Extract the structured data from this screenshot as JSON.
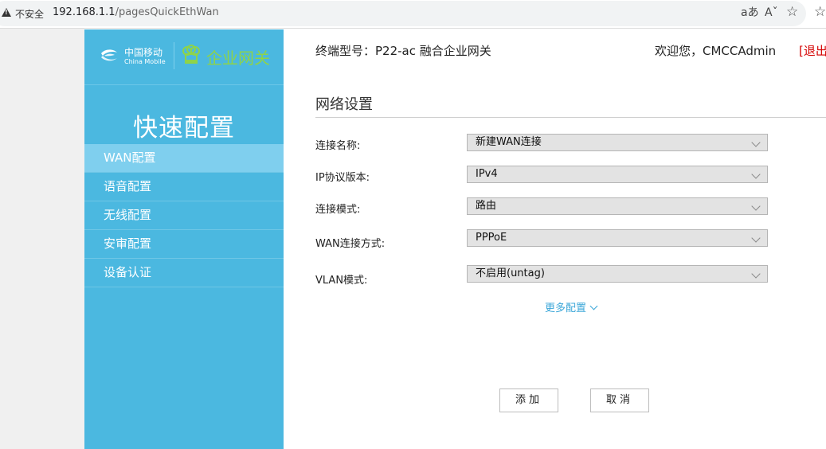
{
  "browser": {
    "security_text": "不安全",
    "url_host": "192.168.1.1",
    "url_path": "/pagesQuickEthWan",
    "icons": [
      "read-aloud-icon",
      "text-size-icon",
      "favorite-star-icon",
      "favorites-list-icon"
    ]
  },
  "sidebar": {
    "brand_cn": "中国移动",
    "brand_en": "China Mobile",
    "product_name": "企业网关",
    "title": "快速配置",
    "items": [
      {
        "label": "WAN配置",
        "active": true
      },
      {
        "label": "语音配置",
        "active": false
      },
      {
        "label": "无线配置",
        "active": false
      },
      {
        "label": "安审配置",
        "active": false
      },
      {
        "label": "设备认证",
        "active": false
      }
    ],
    "colors": {
      "background": "#4bb8e0",
      "active": "#7fcfee",
      "product": "#8ed34a"
    }
  },
  "header": {
    "device_model": "终端型号：P22-ac 融合企业网关",
    "welcome": "欢迎您，CMCCAdmin",
    "logout": "[退出]"
  },
  "form": {
    "section_title": "网络设置",
    "fields": [
      {
        "label": "连接名称:",
        "value": "新建WAN连接"
      },
      {
        "label": "IP协议版本:",
        "value": "IPv4"
      },
      {
        "label": "连接模式:",
        "value": "路由"
      },
      {
        "label": "WAN连接方式:",
        "value": "PPPoE"
      },
      {
        "label": "VLAN模式:",
        "value": "不启用(untag)"
      }
    ],
    "more_config": "更多配置",
    "add_button": "添加",
    "cancel_button": "取消"
  }
}
